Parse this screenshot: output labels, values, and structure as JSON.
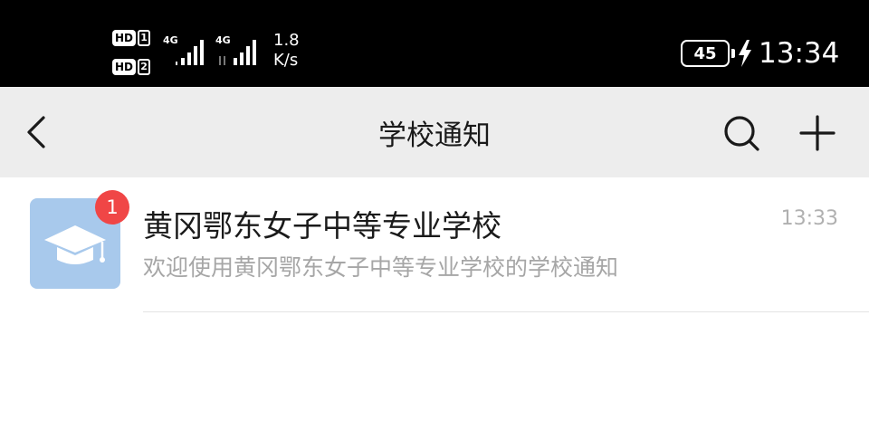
{
  "status_bar": {
    "sim1_label": "HD",
    "sim1_slot": "1",
    "sim2_label": "HD",
    "sim2_slot": "2",
    "network1": "4G",
    "network2": "4G",
    "speed_value": "1.8",
    "speed_unit": "K/s",
    "battery_level": "45",
    "time": "13:34",
    "charging_icon": "lightning-bolt-icon"
  },
  "header": {
    "title": "学校通知",
    "back_icon": "chevron-left-icon",
    "search_icon": "search-icon",
    "add_icon": "plus-icon"
  },
  "chats": [
    {
      "name": "黄冈鄂东女子中等专业学校",
      "preview": "欢迎使用黄冈鄂东女子中等专业学校的学校通知",
      "time": "13:33",
      "unread": "1",
      "avatar_icon": "graduation-cap-icon"
    }
  ],
  "colors": {
    "status_bar_bg": "#000000",
    "header_bg": "#ededed",
    "avatar_bg": "#a8c9ec",
    "badge_red": "#f04646"
  }
}
